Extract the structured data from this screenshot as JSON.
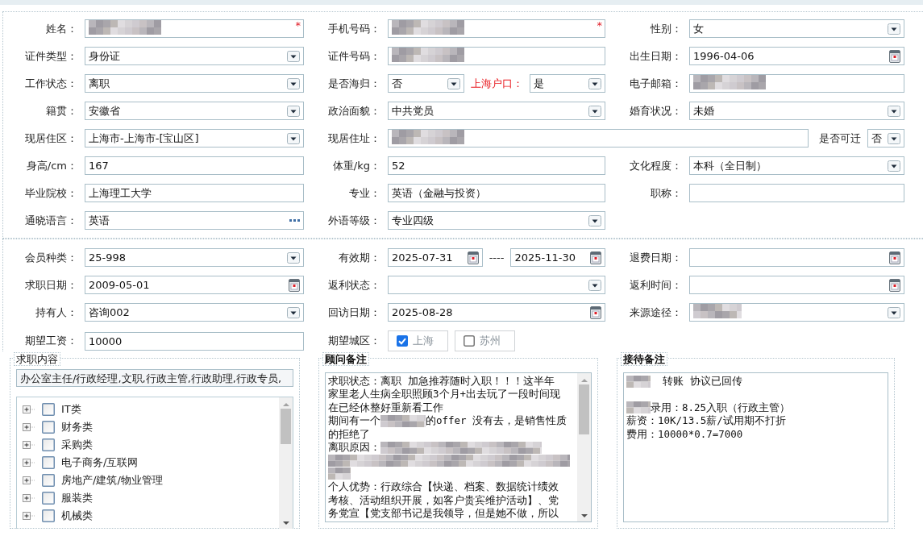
{
  "sections": [
    {
      "rows": [
        [
          {
            "label": "姓名：",
            "fields": [
              {
                "kind": "text",
                "redacted": true,
                "required_mark": "*"
              }
            ]
          },
          {
            "label": "手机号码：",
            "fields": [
              {
                "kind": "text",
                "redacted": true,
                "required_mark": "*"
              }
            ]
          },
          {
            "label": "性别：",
            "fields": [
              {
                "kind": "select",
                "value": "女"
              }
            ]
          }
        ],
        [
          {
            "label": "证件类型：",
            "fields": [
              {
                "kind": "select",
                "value": "身份证"
              }
            ]
          },
          {
            "label": "证件号码：",
            "fields": [
              {
                "kind": "text",
                "redacted": true
              }
            ]
          },
          {
            "label": "出生日期：",
            "fields": [
              {
                "kind": "date",
                "value": "1996-04-06"
              }
            ]
          }
        ],
        [
          {
            "label": "工作状态：",
            "fields": [
              {
                "kind": "select",
                "value": "离职"
              }
            ]
          },
          {
            "label": "是否海归：",
            "fields": [
              {
                "kind": "select",
                "value": "否"
              },
              {
                "kind": "label",
                "text": "上海户口：",
                "highlighted": true
              },
              {
                "kind": "select",
                "value": "是"
              }
            ]
          },
          {
            "label": "电子邮箱：",
            "fields": [
              {
                "kind": "text",
                "redacted": true
              }
            ]
          }
        ],
        [
          {
            "label": "籍贯：",
            "fields": [
              {
                "kind": "select",
                "value": "安徽省"
              }
            ]
          },
          {
            "label": "政治面貌：",
            "fields": [
              {
                "kind": "select",
                "value": "中共党员"
              }
            ]
          },
          {
            "label": "婚育状况：",
            "fields": [
              {
                "kind": "select",
                "value": "未婚"
              }
            ]
          }
        ],
        [
          {
            "label": "现居住区：",
            "fields": [
              {
                "kind": "select",
                "value": "上海市-上海市-[宝山区]"
              }
            ]
          },
          {
            "label": "现居住址：",
            "fields": [
              {
                "kind": "text",
                "redacted": true
              }
            ],
            "trailing": {
              "label": "是否可迁",
              "field": {
                "kind": "select",
                "value": "否"
              }
            }
          }
        ],
        [
          {
            "label": "身高/cm：",
            "fields": [
              {
                "kind": "text",
                "value": "167"
              }
            ]
          },
          {
            "label": "体重/kg：",
            "fields": [
              {
                "kind": "text",
                "value": "52"
              }
            ]
          },
          {
            "label": "文化程度：",
            "fields": [
              {
                "kind": "select",
                "value": "本科（全日制）"
              }
            ]
          }
        ],
        [
          {
            "label": "毕业院校：",
            "fields": [
              {
                "kind": "text",
                "value": "上海理工大学"
              }
            ]
          },
          {
            "label": "专业：",
            "fields": [
              {
                "kind": "text",
                "value": "英语（金融与投资）"
              }
            ]
          },
          {
            "label": "职称：",
            "fields": [
              {
                "kind": "text"
              }
            ]
          }
        ],
        [
          {
            "label": "通晓语言：",
            "fields": [
              {
                "kind": "picker",
                "value": "英语"
              }
            ]
          },
          {
            "label": "外语等级：",
            "fields": [
              {
                "kind": "select",
                "value": "专业四级"
              }
            ]
          }
        ]
      ]
    },
    {
      "rows": [
        [
          {
            "label": "会员种类：",
            "fields": [
              {
                "kind": "select",
                "value": "25-998"
              }
            ]
          },
          {
            "label": "有效期：",
            "fields": [
              {
                "kind": "date",
                "value": "2025-07-31"
              },
              {
                "kind": "label",
                "text": "----",
                "highlighted": false
              },
              {
                "kind": "date",
                "value": "2025-11-30"
              }
            ]
          },
          {
            "label": "退费日期：",
            "fields": [
              {
                "kind": "date"
              }
            ]
          }
        ],
        [
          {
            "label": "求职日期：",
            "fields": [
              {
                "kind": "date",
                "value": "2009-05-01"
              }
            ]
          },
          {
            "label": "返利状态：",
            "fields": [
              {
                "kind": "select"
              }
            ]
          },
          {
            "label": "返利时间：",
            "fields": [
              {
                "kind": "date"
              }
            ]
          }
        ],
        [
          {
            "label": "持有人：",
            "fields": [
              {
                "kind": "select",
                "value": "咨询002"
              }
            ]
          },
          {
            "label": "回访日期：",
            "fields": [
              {
                "kind": "date",
                "value": "2025-08-28"
              }
            ]
          },
          {
            "label": "来源途径：",
            "fields": [
              {
                "kind": "select",
                "redacted": true
              }
            ]
          }
        ],
        [
          {
            "label": "期望工资：",
            "fields": [
              {
                "kind": "text",
                "value": "10000"
              }
            ]
          },
          {
            "label": "期望城区：",
            "fields": [
              {
                "kind": "checkbox",
                "text": "上海",
                "checked": true
              },
              {
                "kind": "checkbox",
                "text": "苏州",
                "checked": false
              }
            ]
          }
        ]
      ]
    }
  ],
  "panels": [
    {
      "kind": "tree",
      "title": "求职内容",
      "summary": "办公室主任/行政经理,文职,行政主管,行政助理,行政专员,",
      "items": [
        {
          "label": "IT类",
          "expanded": false,
          "checked": false
        },
        {
          "label": "财务类",
          "expanded": false,
          "checked": false
        },
        {
          "label": "采购类",
          "expanded": false,
          "checked": false
        },
        {
          "label": "电子商务/互联网",
          "expanded": false,
          "checked": false
        },
        {
          "label": "房地产/建筑/物业管理",
          "expanded": false,
          "checked": false
        },
        {
          "label": "服装类",
          "expanded": false,
          "checked": false
        },
        {
          "label": "机械类",
          "expanded": false,
          "checked": false
        }
      ]
    },
    {
      "kind": "notes",
      "title": "顾问备注",
      "scrollbar": true,
      "lines": [
        {
          "kind": "text",
          "segments": [
            {
              "text": "求职状态：离职 加急推荐随时入职！！！这半年"
            }
          ]
        },
        {
          "kind": "text",
          "segments": [
            {
              "text": "家里老人生病全职照顾3个月+出去玩了一段时间现"
            }
          ]
        },
        {
          "kind": "text",
          "segments": [
            {
              "text": "在已经休整好重新看工作"
            }
          ]
        },
        {
          "kind": "text",
          "segments": [
            {
              "text": "期间有一个"
            },
            {
              "redacted": true
            },
            {
              "text": "的offer 没有去，是销售性质"
            }
          ]
        },
        {
          "kind": "text",
          "segments": [
            {
              "text": "的拒绝了"
            }
          ]
        },
        {
          "kind": "text",
          "segments": [
            {
              "text": "离职原因："
            },
            {
              "redacted": true
            }
          ]
        },
        {
          "kind": "text",
          "segments": [
            {
              "redacted": true
            }
          ]
        },
        {
          "kind": "text",
          "segments": [
            {
              "redacted": true
            }
          ]
        },
        {
          "kind": "text",
          "segments": [
            {
              "text": "个人优势：行政综合【快递、档案、数据统计绩效"
            }
          ]
        },
        {
          "kind": "text",
          "segments": [
            {
              "text": "考核、活动组织开展，如客户贵宾维护活动】、党"
            }
          ]
        },
        {
          "kind": "text",
          "segments": [
            {
              "text": "务党宣【党支部书记是我领导，但是她不做，所以"
            }
          ]
        }
      ]
    },
    {
      "kind": "notes",
      "title": "接待备注",
      "scrollbar": false,
      "lines": [
        {
          "kind": "text",
          "segments": [
            {
              "redacted": true
            },
            {
              "text": "  转账 协议已回传"
            }
          ]
        },
        {
          "kind": "blank"
        },
        {
          "kind": "text",
          "segments": [
            {
              "redacted": true
            },
            {
              "text": "录用：8.25入职（行政主管）"
            }
          ]
        },
        {
          "kind": "text",
          "segments": [
            {
              "text": "薪资：10K/13.5薪/试用期不打折"
            }
          ]
        },
        {
          "kind": "text",
          "segments": [
            {
              "text": "费用：10000*0.7=7000"
            }
          ]
        }
      ]
    }
  ]
}
